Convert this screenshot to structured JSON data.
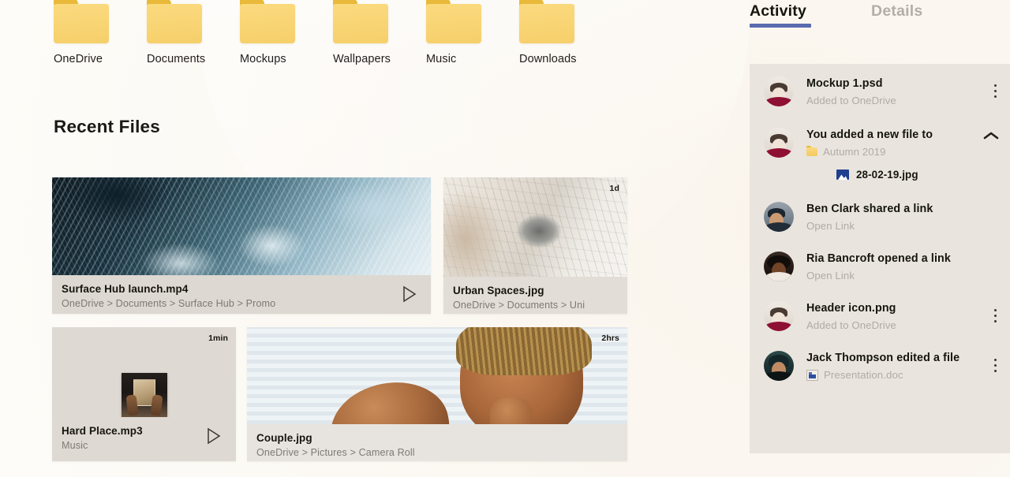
{
  "folders": [
    {
      "label": "OneDrive",
      "icon": "folder-icon"
    },
    {
      "label": "Documents",
      "icon": "folder-icon"
    },
    {
      "label": "Mockups",
      "icon": "folder-icon"
    },
    {
      "label": "Wallpapers",
      "icon": "folder-icon"
    },
    {
      "label": "Music",
      "icon": "folder-icon"
    },
    {
      "label": "Downloads",
      "icon": "folder-icon"
    }
  ],
  "main": {
    "recent_heading": "Recent Files",
    "cards": [
      {
        "name": "Surface Hub launch.mp4",
        "path": "OneDrive > Documents > Surface Hub > Promo",
        "time_badge": "",
        "play_icon": "play-icon",
        "thumb": "ocean-waves-photo"
      },
      {
        "name": "Urban Spaces.jpg",
        "path": "OneDrive > Documents > Uni",
        "time_badge": "1d",
        "play_icon": "",
        "thumb": "urban-architecture-photo"
      },
      {
        "name": "Hard Place.mp3",
        "path": "Music",
        "time_badge": "1min",
        "play_icon": "play-icon",
        "thumb": "album-art-thumbnail"
      },
      {
        "name": "Couple.jpg",
        "path": "OneDrive > Pictures > Camera Roll",
        "time_badge": "2hrs",
        "play_icon": "",
        "thumb": "couple-portrait-photo"
      }
    ]
  },
  "activity_pane": {
    "tabs": [
      {
        "label": "Activity",
        "active": true
      },
      {
        "label": "Details",
        "active": false
      }
    ],
    "accent_color": "#5b6bb0",
    "panel_color": "#e9e5de",
    "items": [
      {
        "title": "Mockup 1.psd",
        "subtitle": "Added to OneDrive",
        "sub_icon": "",
        "menu": "kebab-icon",
        "chevron": "",
        "avatar": "avatar-woman-maroon",
        "child": null
      },
      {
        "title": "You added a new file to",
        "subtitle": "Autumn 2019",
        "sub_icon": "folder-icon",
        "menu": "",
        "chevron": "chevron-up-icon",
        "avatar": "avatar-woman-maroon",
        "child": {
          "label": "28-02-19.jpg",
          "icon": "image-icon"
        }
      },
      {
        "title": "Ben Clark shared a link",
        "subtitle": "Open Link",
        "sub_icon": "",
        "menu": "",
        "chevron": "",
        "avatar": "avatar-man-suit",
        "child": null
      },
      {
        "title": "Ria Bancroft opened a link",
        "subtitle": "Open Link",
        "sub_icon": "",
        "menu": "",
        "chevron": "",
        "avatar": "avatar-woman-dark",
        "child": null
      },
      {
        "title": "Header icon.png",
        "subtitle": "Added to OneDrive",
        "sub_icon": "",
        "menu": "kebab-icon",
        "chevron": "",
        "avatar": "avatar-woman-maroon",
        "child": null
      },
      {
        "title": "Jack Thompson edited a file",
        "subtitle": "Presentation.doc",
        "sub_icon": "doc-icon",
        "menu": "kebab-icon",
        "chevron": "",
        "avatar": "avatar-man-teal",
        "child": null
      }
    ]
  }
}
